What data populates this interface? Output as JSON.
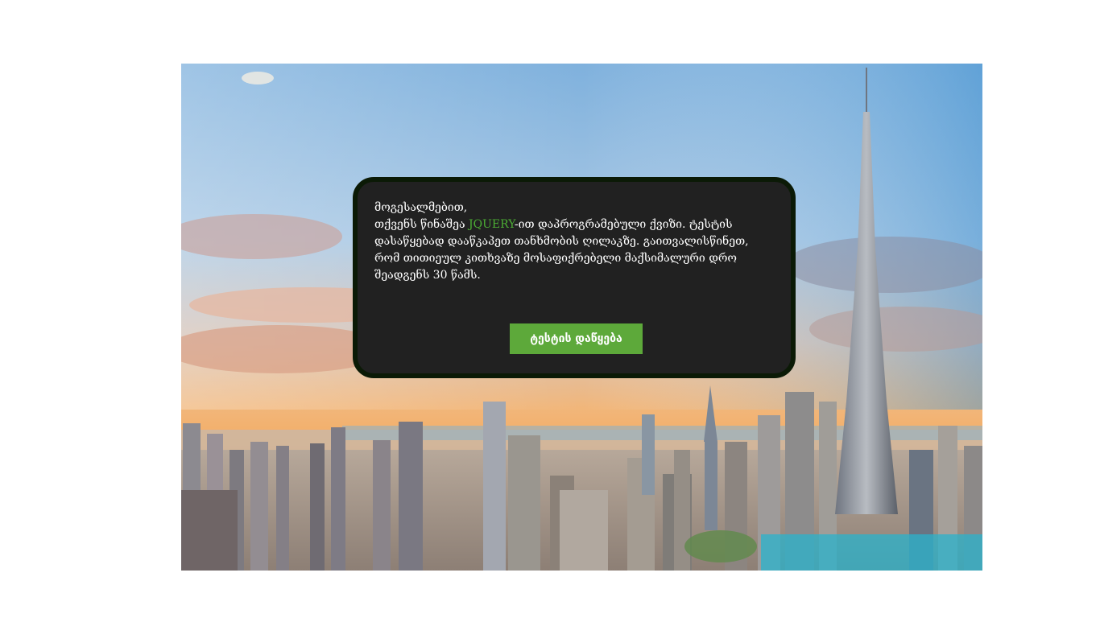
{
  "quiz": {
    "greeting": "მოგესალმებით,",
    "line_part1": "თქვენს წინაშეა ",
    "technology": "JQUERY",
    "line_part2": "-ით დაპროგრამებული ქვიზი. ტესტის დასაწყებად დააწკაპეთ თანხმობის ღილაკზე. გაითვალისწინეთ, რომ თითიეულ კითხვაზე მოსაფიქრებელი მაქსიმალური დრო შეადგენს 30 წამს.",
    "start_button_label": "ტესტის დაწყება"
  },
  "colors": {
    "card_background": "#212121",
    "card_border": "#0b1a06",
    "highlight_text": "#4cae34",
    "button_background": "#5da93a"
  },
  "background_image": {
    "icon": "city-skyline-image"
  }
}
